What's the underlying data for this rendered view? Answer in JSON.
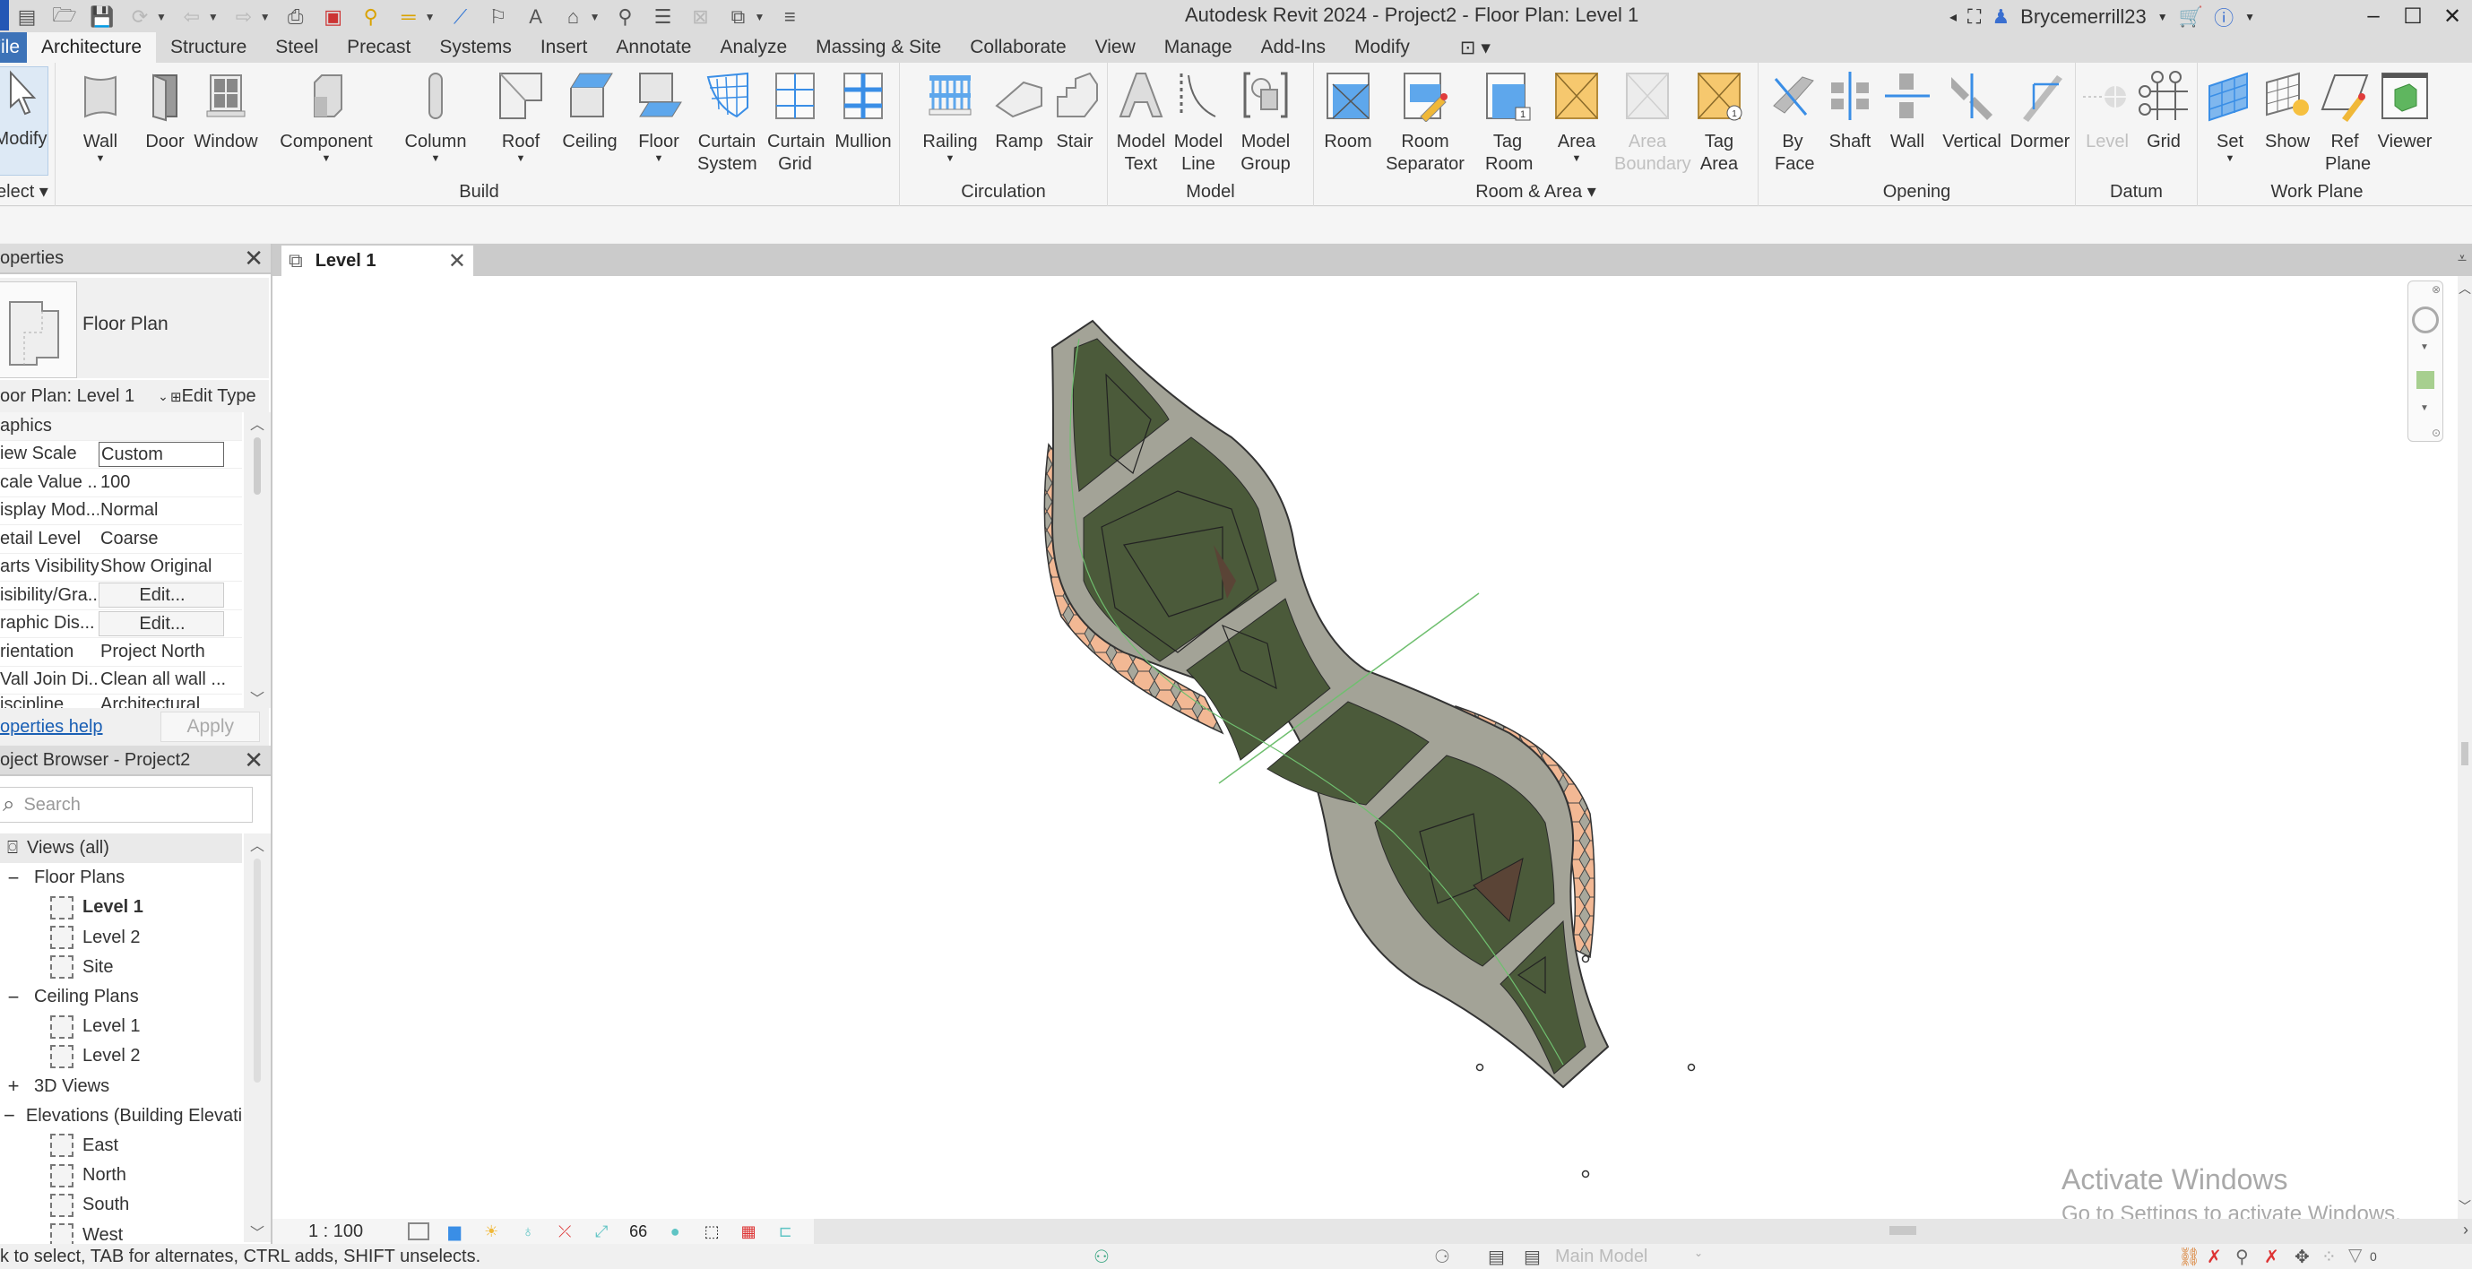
{
  "app": {
    "title": "Autodesk Revit 2024 - Project2 - Floor Plan: Level 1",
    "user": "Brycemerrill23"
  },
  "quick_access": {
    "icons": [
      "home-icon",
      "open-icon",
      "save-icon",
      "sync-icon",
      "undo-icon",
      "redo-icon",
      "print-icon",
      "pdf-icon",
      "pin-icon",
      "measure-icon",
      "aligned-dimension-icon",
      "tag-icon",
      "text-icon",
      "3d-view-icon",
      "section-icon",
      "thin-lines-icon",
      "close-hidden-icon",
      "switch-windows-icon",
      "customize-icon"
    ]
  },
  "ribbon_tabs": [
    {
      "label": "File"
    },
    {
      "label": "Architecture",
      "active": true
    },
    {
      "label": "Structure"
    },
    {
      "label": "Steel"
    },
    {
      "label": "Precast"
    },
    {
      "label": "Systems"
    },
    {
      "label": "Insert"
    },
    {
      "label": "Annotate"
    },
    {
      "label": "Analyze"
    },
    {
      "label": "Massing & Site"
    },
    {
      "label": "Collaborate"
    },
    {
      "label": "View"
    },
    {
      "label": "Manage"
    },
    {
      "label": "Add-Ins"
    },
    {
      "label": "Modify"
    }
  ],
  "ribbon": {
    "select": {
      "tool": "Modify",
      "label": "elect ▾"
    },
    "build": {
      "label": "Build",
      "tools": [
        "Wall",
        "Door",
        "Window",
        "Component",
        "Column",
        "Roof",
        "Ceiling",
        "Floor",
        "Curtain System",
        "Curtain Grid",
        "Mullion"
      ]
    },
    "circulation": {
      "label": "Circulation",
      "tools": [
        "Railing",
        "Ramp",
        "Stair"
      ]
    },
    "model": {
      "label": "Model",
      "tools": [
        "Model Text",
        "Model Line",
        "Model Group"
      ]
    },
    "room_area": {
      "label": "Room & Area ▾",
      "tools": [
        "Room",
        "Room Separator",
        "Tag Room",
        "Area",
        "Area Boundary",
        "Tag Area"
      ]
    },
    "opening": {
      "label": "Opening",
      "tools": [
        "By Face",
        "Shaft",
        "Wall",
        "Vertical",
        "Dormer"
      ]
    },
    "datum": {
      "label": "Datum",
      "tools": [
        "Level",
        "Grid"
      ]
    },
    "work_plane": {
      "label": "Work Plane",
      "tools": [
        "Set",
        "Show",
        "Ref Plane",
        "Viewer"
      ]
    }
  },
  "properties": {
    "title": "operties",
    "type_name": "Floor Plan",
    "instance": "oor Plan: Level 1",
    "edit_type": "Edit Type",
    "group": "aphics",
    "rows": [
      {
        "key": "iew Scale",
        "value": "Custom",
        "kind": "box"
      },
      {
        "key": "cale Value ...",
        "value": "100"
      },
      {
        "key": "isplay Mod...",
        "value": "Normal"
      },
      {
        "key": "etail Level",
        "value": "Coarse"
      },
      {
        "key": "arts Visibility",
        "value": "Show Original"
      },
      {
        "key": "isibility/Gra...",
        "value": "Edit...",
        "kind": "btn"
      },
      {
        "key": "raphic Dis...",
        "value": "Edit...",
        "kind": "btn"
      },
      {
        "key": "rientation",
        "value": "Project North"
      },
      {
        "key": "Vall Join Di...",
        "value": "Clean all wall ..."
      },
      {
        "key": "iscipline",
        "value": "Architectural"
      }
    ],
    "help": "operties help",
    "apply": "Apply"
  },
  "browser": {
    "title": "oject Browser - Project2",
    "search_placeholder": "Search",
    "tree": [
      {
        "label": "Views (all)",
        "type": "root"
      },
      {
        "label": "Floor Plans",
        "type": "group",
        "sign": "−"
      },
      {
        "label": "Level 1",
        "type": "leaf",
        "bold": true
      },
      {
        "label": "Level 2",
        "type": "leaf"
      },
      {
        "label": "Site",
        "type": "leaf"
      },
      {
        "label": "Ceiling Plans",
        "type": "group",
        "sign": "−"
      },
      {
        "label": "Level 1",
        "type": "leaf"
      },
      {
        "label": "Level 2",
        "type": "leaf"
      },
      {
        "label": "3D Views",
        "type": "group",
        "sign": "+"
      },
      {
        "label": "Elevations (Building Elevati",
        "type": "group",
        "sign": "−"
      },
      {
        "label": "East",
        "type": "leaf"
      },
      {
        "label": "North",
        "type": "leaf"
      },
      {
        "label": "South",
        "type": "leaf"
      },
      {
        "label": "West",
        "type": "leaf"
      }
    ]
  },
  "view": {
    "tab_label": "Level 1",
    "scale": "1 : 100"
  },
  "status": {
    "hint": "k to select, TAB for alternates, CTRL adds, SHIFT unselects.",
    "model": "Main Model"
  },
  "watermark": {
    "line1": "Activate Windows",
    "line2": "Go to Settings to activate Windows."
  },
  "colors": {
    "file_tab": "#3d73b8",
    "floor_fill": "#4b5a3a",
    "wall_fill": "#a3a397",
    "panel_orange": "#f2b894",
    "ref_line": "#6fbf6f"
  }
}
